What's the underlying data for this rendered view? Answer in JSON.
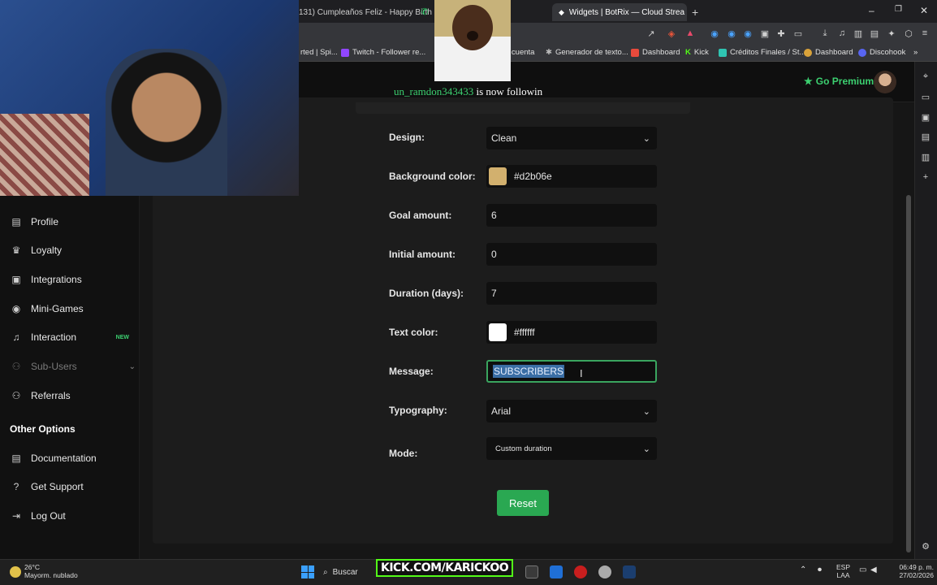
{
  "browser": {
    "tabs": [
      {
        "title": "131) Cumpleaños Feliz - Happy Birth"
      },
      {
        "title": "Widgets | BotRix — Cloud Strea",
        "active": true
      }
    ],
    "bookmarks": [
      {
        "label": "rted | Spi...",
        "color": "#ffffff"
      },
      {
        "label": "Twitch - Follower re...",
        "color": "#9146ff"
      },
      {
        "label": "a cuenta",
        "color": "#888888"
      },
      {
        "label": "Generador de texto...",
        "color": "#bbbbbb"
      },
      {
        "label": "Dashboard",
        "color": "#e84a3c"
      },
      {
        "label": "Kick",
        "color": "#53fc18"
      },
      {
        "label": "Créditos Finales / St...",
        "color": "#2fc4b2"
      },
      {
        "label": "Dashboard",
        "color": "#d9a23a"
      },
      {
        "label": "Discohook",
        "color": "#5865f2"
      }
    ]
  },
  "header": {
    "premium_label": "Go Premium"
  },
  "notification": {
    "username": "un_ramdon343433",
    "text": "is now followin"
  },
  "sidebar": {
    "items": [
      {
        "label": "Profile",
        "icon": "profile-card-icon"
      },
      {
        "label": "Loyalty",
        "icon": "trophy-icon"
      },
      {
        "label": "Integrations",
        "icon": "integrations-icon"
      },
      {
        "label": "Mini-Games",
        "icon": "gamepad-icon"
      },
      {
        "label": "Interaction",
        "icon": "music-note-icon",
        "badge": "NEW"
      },
      {
        "label": "Sub-Users",
        "icon": "sub-users-icon",
        "disabled": true
      },
      {
        "label": "Referrals",
        "icon": "referrals-icon"
      }
    ],
    "section_title": "Other Options",
    "other_items": [
      {
        "label": "Documentation",
        "icon": "document-icon"
      },
      {
        "label": "Get Support",
        "icon": "help-icon"
      },
      {
        "label": "Log Out",
        "icon": "logout-icon"
      }
    ]
  },
  "form": {
    "design_label": "Design:",
    "design_value": "Clean",
    "background_color_label": "Background color:",
    "background_color_value": "#d2b06e",
    "goal_amount_label": "Goal amount:",
    "goal_amount_value": "6",
    "initial_amount_label": "Initial amount:",
    "initial_amount_value": "0",
    "duration_label": "Duration (days):",
    "duration_value": "7",
    "text_color_label": "Text color:",
    "text_color_value": "#ffffff",
    "message_label": "Message:",
    "message_value": "SUBSCRIBERS",
    "typography_label": "Typography:",
    "typography_value": "Arial",
    "mode_label": "Mode:",
    "mode_value": "Custom duration",
    "reset_label": "Reset"
  },
  "taskbar": {
    "temperature": "26°C",
    "weather": "Mayorm. nublado",
    "search_label": "Buscar",
    "kick_banner": "KICK.COM/KARICKOO",
    "language_top": "ESP",
    "language_bottom": "LAA",
    "time": "06:49 p. m.",
    "date": "27/02/2026"
  },
  "colors": {
    "accent": "#3cd070",
    "reset_button": "#2aa852",
    "background_swatch": "#d2b06e",
    "text_swatch": "#ffffff"
  }
}
